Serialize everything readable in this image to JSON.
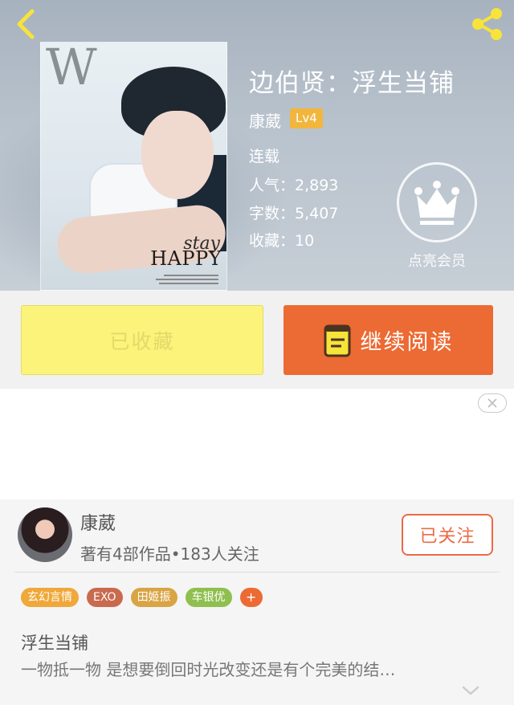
{
  "book": {
    "title": "边伯贤：浮生当铺",
    "author": "康葳",
    "level": "Lv4",
    "status": "连载",
    "popularity": "人气：2,893",
    "word_count": "字数：5,407",
    "favorites": "收藏：10"
  },
  "cover": {
    "logo": "W",
    "line1": "stay",
    "line2": "HAPPY"
  },
  "vip": {
    "label": "点亮会员"
  },
  "actions": {
    "collect_label": "已收藏",
    "read_label": "继续阅读"
  },
  "author_card": {
    "name": "康葳",
    "meta": "著有4部作品•183人关注",
    "follow_label": "已关注"
  },
  "tags": [
    {
      "label": "玄幻言情",
      "color": "#f0a83a"
    },
    {
      "label": "EXO",
      "color": "#c96a4f"
    },
    {
      "label": "田姬振",
      "color": "#d9a444"
    },
    {
      "label": "车银优",
      "color": "#8fbf4e"
    },
    {
      "label": "+",
      "color": "#ec6a33"
    }
  ],
  "synopsis": {
    "book_name": "浮生当铺",
    "text": "一物抵一物 是想要倒回时光改变还是有个完美的结…"
  },
  "colors": {
    "accent_orange": "#ec6a33",
    "collect_yellow": "#fbf37a",
    "level_badge": "#f2b63d",
    "follow_border": "#ec6a45"
  }
}
